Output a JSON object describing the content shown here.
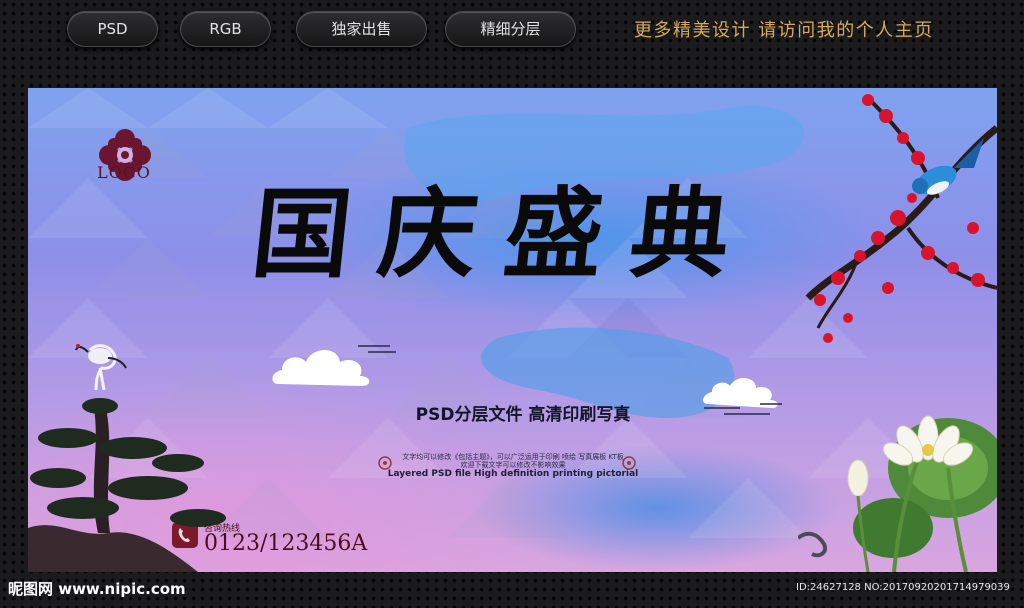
{
  "top_bar": {
    "pills": [
      "PSD",
      "RGB",
      "独家出售",
      "精细分层"
    ],
    "tagline": "更多精美设计  请访问我的个人主页"
  },
  "banner": {
    "logo_text": "LOGO",
    "title": "国庆盛典",
    "subtitle": "PSD分层文件  高清印刷写真",
    "small_text_line1": "文字均可以修改《包括主题》，可以广泛运用于印刷 喷绘 写真展板 KT板",
    "small_text_line2": "欢迎下载文字可以修改不影响效果",
    "english_line": "Layered PSD file High definition printing pictorial",
    "hotline_label": "咨询热线",
    "hotline_number": "0123/123456A"
  },
  "footer": {
    "brand": "昵图网 www.nipic.com",
    "id_text": "ID:24627128 NO:20170920201714979039"
  },
  "colors": {
    "background": "#1b1b1d",
    "tagline": "#d6aa5a",
    "logo": "#6b1530",
    "blossom": "#d8142c"
  }
}
